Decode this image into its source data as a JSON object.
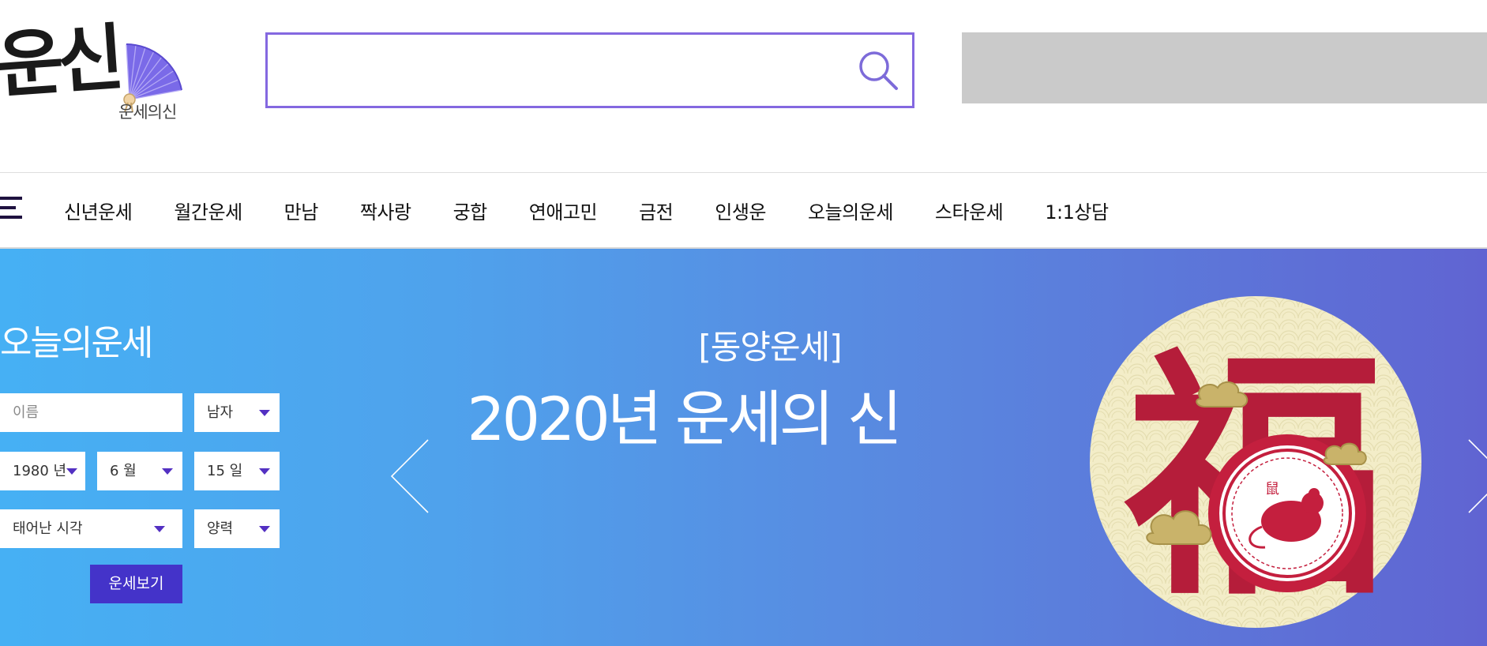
{
  "header": {
    "logo_main": "운신",
    "logo_sub": "운세의신",
    "search_placeholder": ""
  },
  "nav": {
    "items": [
      "신년운세",
      "월간운세",
      "만남",
      "짝사랑",
      "궁합",
      "연애고민",
      "금전",
      "인생운",
      "오늘의운세",
      "스타운세",
      "1:1상담"
    ]
  },
  "fortune_form": {
    "title": "오늘의운세",
    "name_placeholder": "이름",
    "gender": "남자",
    "year": "1980 년",
    "month": "6 월",
    "day": "15 일",
    "birth_time": "태어난 시각",
    "calendar": "양력",
    "submit_label": "운세보기"
  },
  "slide": {
    "category": "[동양운세]",
    "title": "2020년 운세의 신",
    "image_glyph": "福",
    "stamp_glyph": "鼠"
  },
  "colors": {
    "accent_purple": "#8468e0",
    "button_purple": "#4433c9",
    "hero_gradient_start": "#46b0f4",
    "hero_gradient_end": "#6064d2",
    "ad_gray": "#cacaca"
  }
}
